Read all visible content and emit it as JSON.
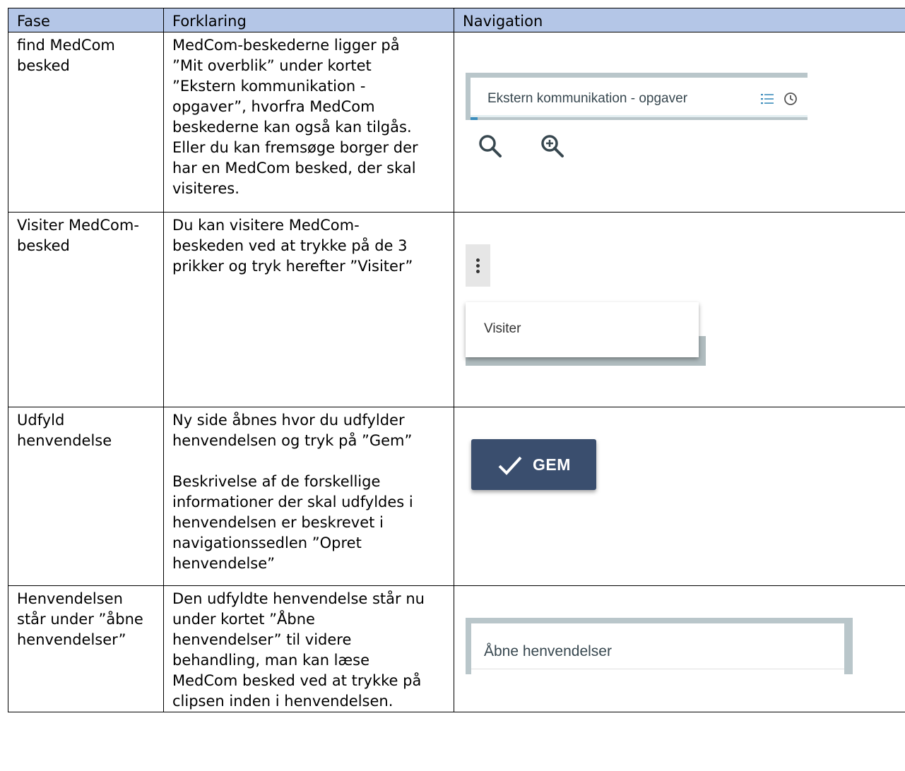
{
  "table": {
    "headers": [
      "Fase",
      "Forklaring",
      "Navigation"
    ],
    "rows": [
      {
        "fase": "find MedCom\nbesked",
        "forklaring": "MedCom-beskederne ligger  på\n”Mit overblik” under kortet\n”Ekstern kommunikation -\nopgaver”, hvorfra MedCom\nbeskederne kan også kan tilgås.\nEller du kan fremsøge  borger der\nhar en MedCom besked, der skal\nvisiteres.",
        "navigation": {
          "card_title": "Ekstern kommunikation - opgaver",
          "icons": [
            "list-icon",
            "clock-icon",
            "search-icon",
            "zoom-in-icon"
          ]
        }
      },
      {
        "fase": "Visiter MedCom-\nbesked",
        "forklaring": "Du kan visitere MedCom-\nbeskeden ved at trykke på de 3\nprikker og tryk herefter ”Visiter”",
        "navigation": {
          "menu_item": "Visiter",
          "icons": [
            "kebab-menu-icon"
          ]
        }
      },
      {
        "fase": "Udfyld\nhenvendelse",
        "forklaring_p1": "Ny side åbnes hvor du udfylder\nhenvendelsen og tryk på ”Gem”",
        "forklaring_p2": "Beskrivelse af de forskellige\ninformationer der skal udfyldes i\nhenvendelsen er beskrevet i\nnavigationssedlen ”Opret\nhenvendelse”",
        "navigation": {
          "button_label": "GEM",
          "icons": [
            "checkmark-icon"
          ]
        }
      },
      {
        "fase": "Henvendelsen\nstår under ”åbne\nhenvendelser”",
        "forklaring": "Den udfyldte henvendelse står nu\nunder kortet ”Åbne\nhenvendelser” til videre\nbehandling, man kan læse\nMedCom besked ved at trykke på\nclipsen inden i henvendelsen.",
        "navigation": {
          "card_title": "Åbne henvendelser"
        }
      }
    ]
  },
  "colors": {
    "header_bg": "#b4c6e7",
    "button_bg": "#3a4e6e",
    "card_frame": "#b9c6ca"
  }
}
